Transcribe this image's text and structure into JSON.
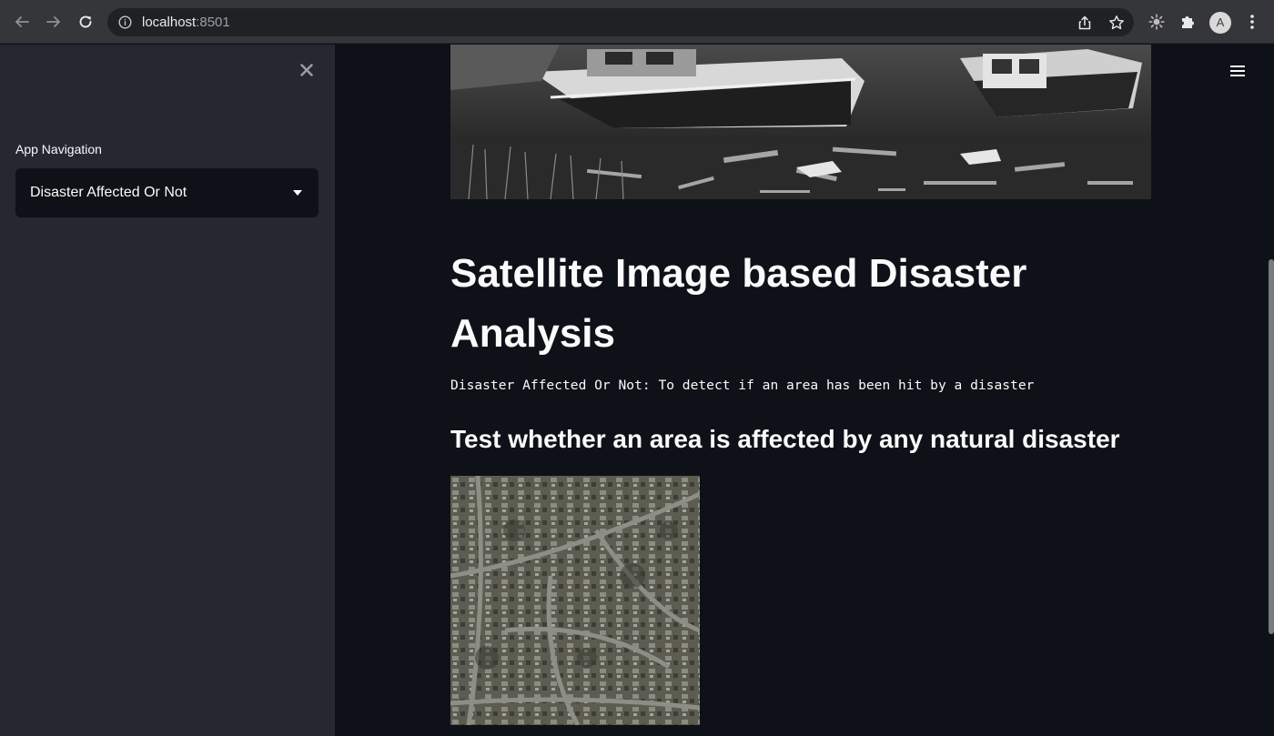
{
  "browser": {
    "url_host": "localhost",
    "url_port": ":8501",
    "profile_initial": "A"
  },
  "sidebar": {
    "nav_label": "App Navigation",
    "selected_option": "Disaster Affected Or Not"
  },
  "main": {
    "title": "Satellite Image based Disaster Analysis",
    "mode_description": "Disaster Affected Or Not: To detect if an area has been hit by a disaster",
    "section_heading": "Test whether an area is affected by any natural disaster"
  },
  "colors": {
    "sidebar_bg": "#262730",
    "main_bg": "#0e1117",
    "text": "#fafafa",
    "chrome_bg": "#35363a"
  },
  "icons": [
    "back-icon",
    "forward-icon",
    "reload-icon",
    "info-icon",
    "share-icon",
    "star-icon",
    "extension-sun-icon",
    "puzzle-icon",
    "kebab-menu-icon",
    "close-icon",
    "caret-down-icon",
    "hamburger-menu-icon"
  ]
}
